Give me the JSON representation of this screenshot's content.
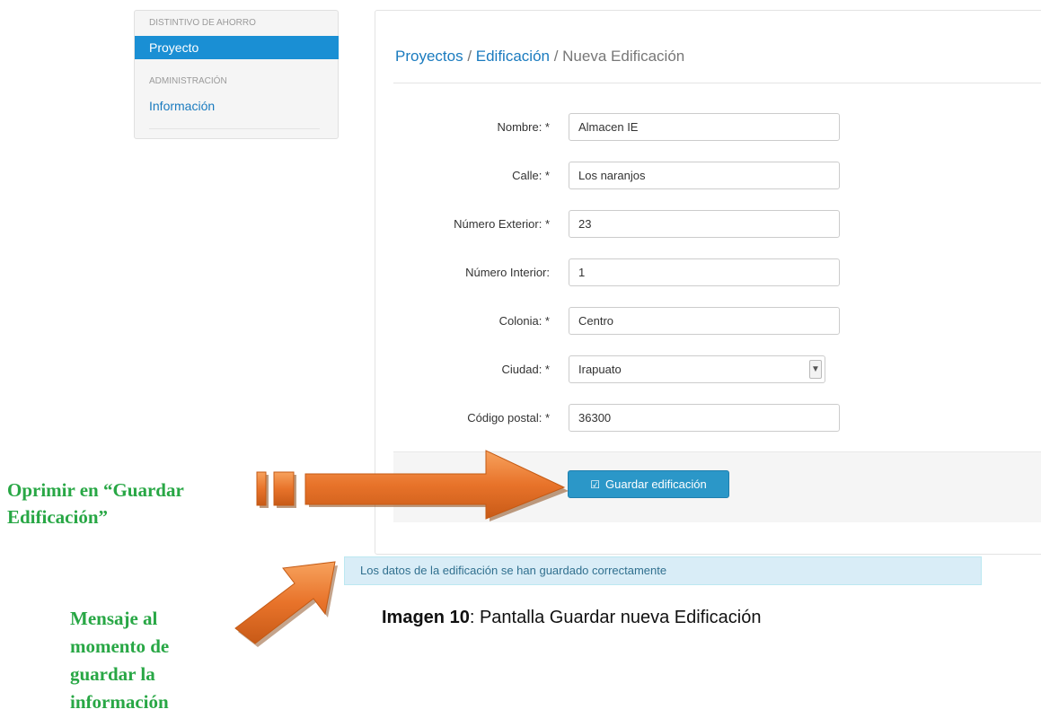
{
  "sidebar": {
    "section1_header": "DISTINTIVO DE AHORRO",
    "item_proyecto": "Proyecto",
    "section2_header": "ADMINISTRACIÓN",
    "item_informacion": "Información"
  },
  "breadcrumb": {
    "level1": "Proyectos",
    "sep1": " / ",
    "level2": "Edificación",
    "sep2": " / ",
    "current": "Nueva Edificación"
  },
  "form": {
    "nombre_label": "Nombre: *",
    "nombre_value": "Almacen IE",
    "calle_label": "Calle: *",
    "calle_value": "Los naranjos",
    "num_ext_label": "Número Exterior: *",
    "num_ext_value": "23",
    "num_int_label": "Número Interior:",
    "num_int_value": "1",
    "colonia_label": "Colonia: *",
    "colonia_value": "Centro",
    "ciudad_label": "Ciudad: *",
    "ciudad_value": "Irapuato",
    "cp_label": "Código postal: *",
    "cp_value": "36300"
  },
  "actions": {
    "save_label": "Guardar edificación",
    "save_icon": "check-square-icon"
  },
  "alert": {
    "message": "Los datos de la edificación se han guardado correctamente"
  },
  "caption": {
    "bold": "Imagen 10",
    "text": ": Pantalla Guardar nueva Edificación"
  },
  "annotations": {
    "left_line1": "Oprimir en “Guardar",
    "left_line2": "Edificación”",
    "bottom_line1": "Mensaje al",
    "bottom_line2": "momento de",
    "bottom_line3": "guardar la",
    "bottom_line4": "información"
  },
  "colors": {
    "accent_blue": "#1a8fd4",
    "button_blue": "#2b97c8",
    "arrow_orange": "#e8732a",
    "note_green": "#28a745",
    "alert_bg": "#d9edf7"
  }
}
